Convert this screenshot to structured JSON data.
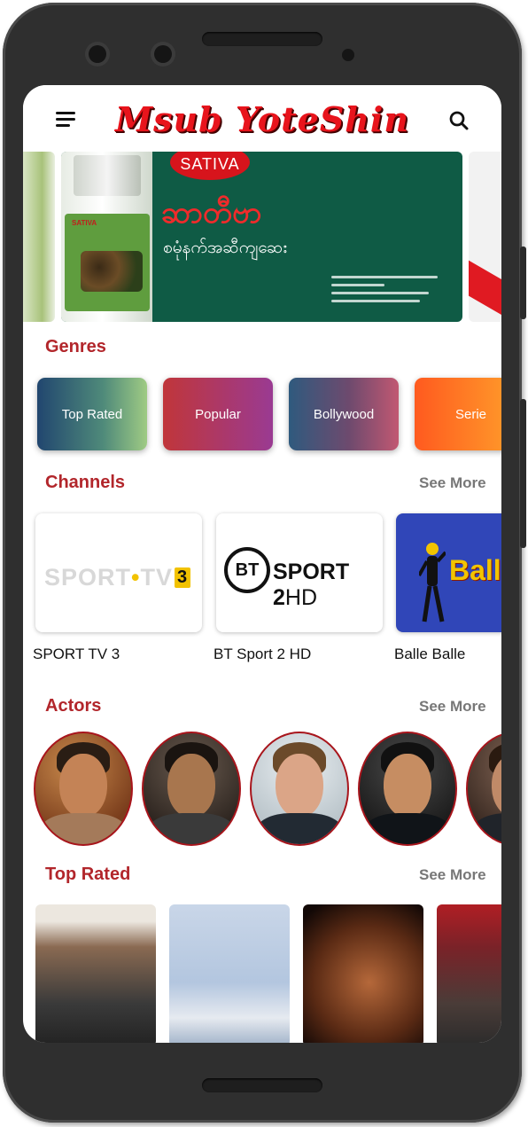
{
  "app": {
    "title": "Msub YoteShin"
  },
  "banner": {
    "badge": "SATIVA",
    "bottle_brand": "SATIVA",
    "headline": "ဆာတီဗာ",
    "subline": "စမုံနက်အဆီကျဆေး"
  },
  "genres": {
    "title": "Genres",
    "items": [
      {
        "label": "Top Rated"
      },
      {
        "label": "Popular"
      },
      {
        "label": "Bollywood"
      },
      {
        "label": "Serie"
      }
    ]
  },
  "channels": {
    "title": "Channels",
    "see_more": "See More",
    "items": [
      {
        "name": "SPORT TV 3",
        "logo_text": "SPORT",
        "logo_sep": "•",
        "logo_text2": "TV",
        "logo_num": "3"
      },
      {
        "name": "BT Sport 2 HD",
        "logo_bt": "BT",
        "logo_sport": "SPORT 2",
        "logo_hd": "HD"
      },
      {
        "name": "Balle Balle",
        "logo_text": "Balle"
      }
    ]
  },
  "actors": {
    "title": "Actors",
    "see_more": "See More"
  },
  "top_rated": {
    "title": "Top Rated",
    "see_more": "See More"
  },
  "colors": {
    "accent": "#b2262b",
    "title_red": "#e8141c",
    "see_more": "#777777"
  }
}
